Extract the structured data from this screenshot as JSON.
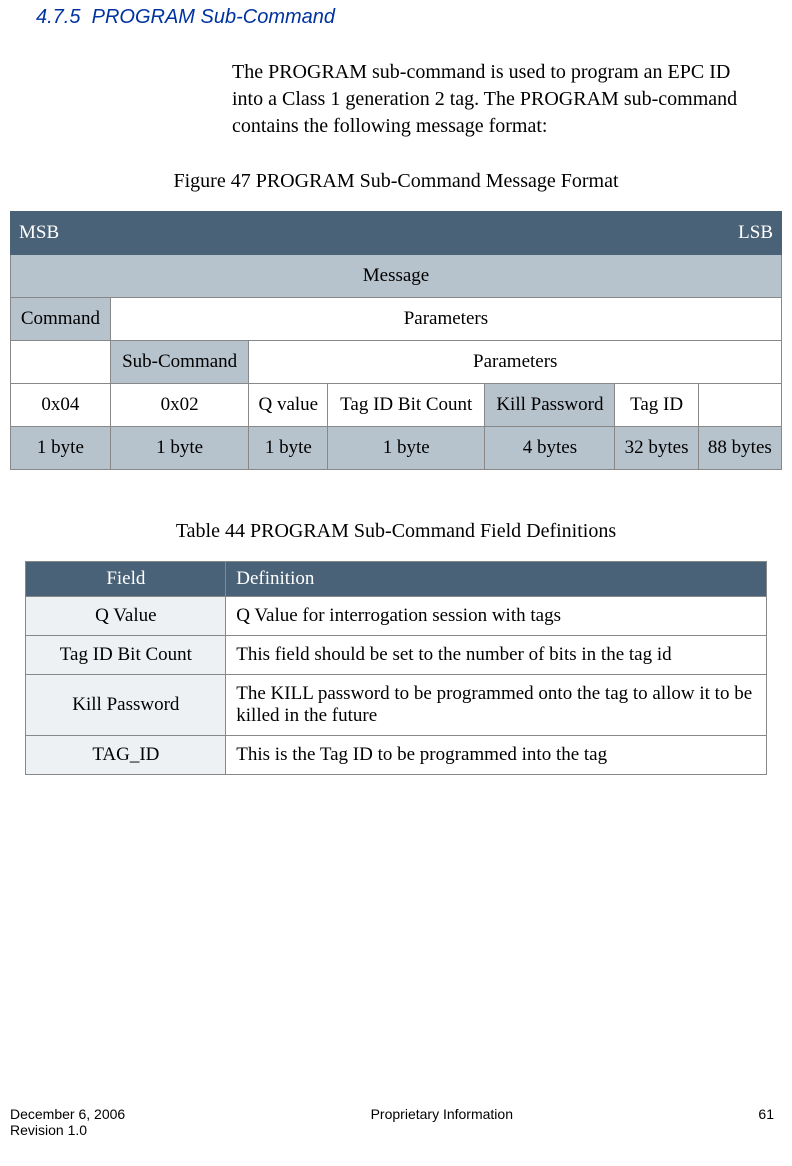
{
  "section": {
    "number": "4.7.5",
    "title": "PROGRAM Sub-Command"
  },
  "paragraph": "The PROGRAM sub-command is used to program an EPC ID into a Class 1 generation 2 tag.  The PROGRAM sub-command contains the following message format:",
  "figure_caption": "Figure 47 PROGRAM Sub-Command Message Format",
  "table_caption": "Table 44 PROGRAM Sub-Command Field Definitions",
  "msg_table": {
    "msb": "MSB",
    "lsb": "LSB",
    "message": "Message",
    "command": "Command",
    "parameters": "Parameters",
    "sub_command": "Sub-Command",
    "parameters2": "Parameters",
    "row_values": [
      "0x04",
      "0x02",
      "Q value",
      "Tag ID Bit Count",
      "Kill Password",
      "Tag ID",
      ""
    ],
    "row_sizes": [
      "1 byte",
      "1 byte",
      "1 byte",
      "1 byte",
      "4 bytes",
      "32 bytes",
      "88 bytes"
    ]
  },
  "def_table": {
    "headers": {
      "field": "Field",
      "definition": "Definition"
    },
    "rows": [
      {
        "field": "Q Value",
        "definition": "Q Value for interrogation session with tags"
      },
      {
        "field": "Tag ID Bit Count",
        "definition": "This field should be set to the number of bits in the tag id"
      },
      {
        "field": "Kill Password",
        "definition": "The KILL password to be programmed onto the tag to allow it to be killed in the future"
      },
      {
        "field": "TAG_ID",
        "definition": "This is the Tag ID to be programmed into the tag"
      }
    ]
  },
  "footer": {
    "date": "December 6, 2006",
    "revision": "Revision 1.0",
    "center": "Proprietary Information",
    "page": "61"
  }
}
